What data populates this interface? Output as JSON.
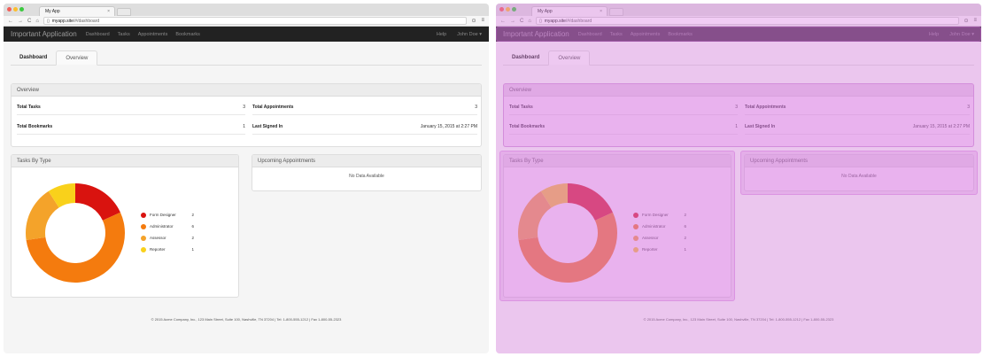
{
  "colors": {
    "form_designer": "#d9130f",
    "administrator": "#f47b0e",
    "assessor": "#f4a32a",
    "reporter": "#f9d11b",
    "overlay": "#d978e2",
    "navbar": "#222222"
  },
  "browser": {
    "tab_title": "My App",
    "tab_close": "×",
    "url_host": "myapp.site",
    "url_path": "/#/dashboard",
    "back_icon": "arrow-left-icon",
    "forward_icon": "arrow-right-icon",
    "reload_icon": "reload-icon",
    "home_icon": "home-icon",
    "page_icon": "page-icon",
    "menu_icon": "hamburger-icon",
    "ext_icon": "extension-icon"
  },
  "navbar": {
    "brand": "Important Application",
    "links": [
      "Dashboard",
      "Tasks",
      "Appointments",
      "Bookmarks"
    ],
    "help": "Help",
    "user": "John Doe ▾"
  },
  "tabs": {
    "title": "Dashboard",
    "overview": "Overview"
  },
  "overview": {
    "heading": "Overview",
    "total_tasks_label": "Total Tasks",
    "total_tasks_value": "3",
    "total_appointments_label": "Total Appointments",
    "total_appointments_value": "3",
    "total_bookmarks_label": "Total Bookmarks",
    "total_bookmarks_value": "1",
    "last_signed_label": "Last Signed In",
    "last_signed_value": "January 15, 2015 at 2:27 PM"
  },
  "tasks_by_type": {
    "heading": "Tasks By Type",
    "items": [
      {
        "label": "Form Designer",
        "value": "2",
        "count": 2
      },
      {
        "label": "Administrator",
        "value": "6",
        "count": 6
      },
      {
        "label": "Assessor",
        "value": "2",
        "count": 2
      },
      {
        "label": "Reporter",
        "value": "1",
        "count": 1
      }
    ]
  },
  "appointments": {
    "heading": "Upcoming Appointments",
    "empty": "No Data Available"
  },
  "footer": "© 2015 Acme Company, Inc., 123 Main Street, Suite 100, Nashville, TN 37204 | Tel: 1-800-555-1212 | Fax 1-800-55-2323"
}
